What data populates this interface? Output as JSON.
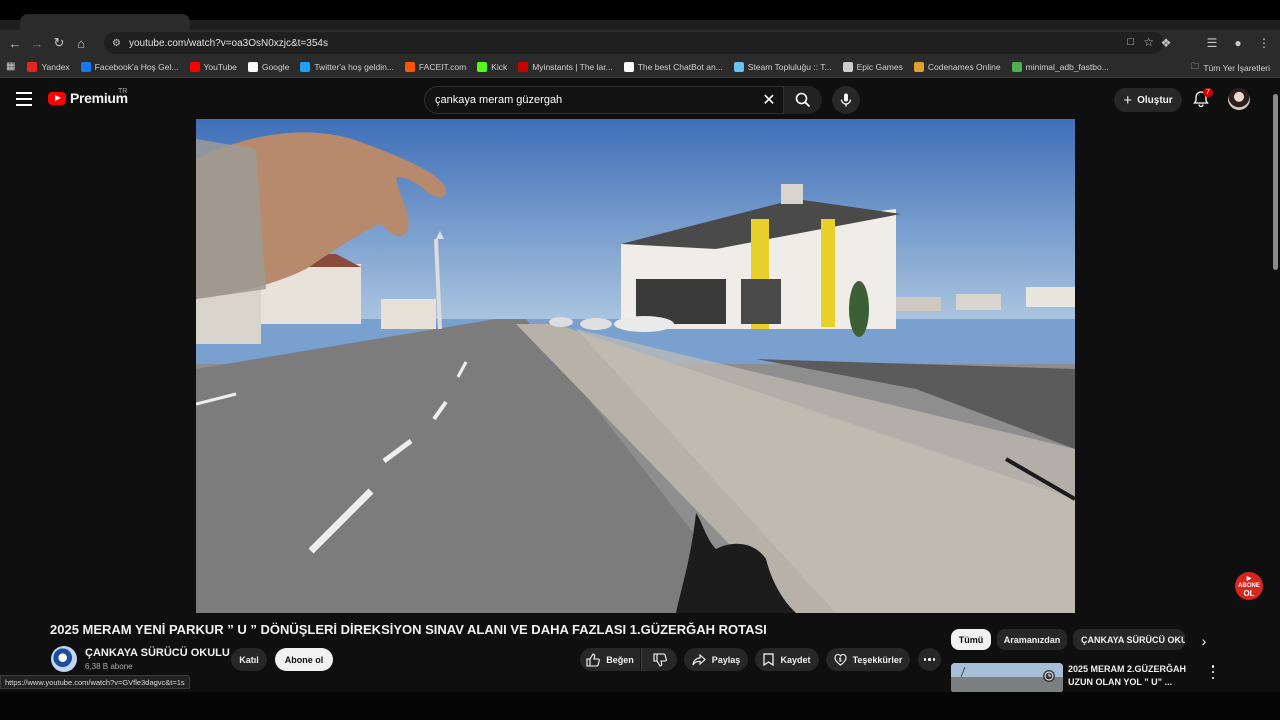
{
  "browser": {
    "url": "youtube.com/watch?v=oa3OsN0xzjc&t=354s",
    "bookmarks": [
      {
        "label": "Yandex",
        "color": "#e52620"
      },
      {
        "label": "Facebook'a Hoş Gel...",
        "color": "#1877f2"
      },
      {
        "label": "YouTube",
        "color": "#ff0000"
      },
      {
        "label": "Google",
        "color": "#ffffff"
      },
      {
        "label": "Twitter'a hoş geldin...",
        "color": "#1da1f2"
      },
      {
        "label": "FACEIT.com",
        "color": "#ff5500"
      },
      {
        "label": "Kick",
        "color": "#53fc18"
      },
      {
        "label": "Myinstants | The lar...",
        "color": "#cc0000"
      },
      {
        "label": "The best ChatBot an...",
        "color": "#ffffff"
      },
      {
        "label": "Steam Topluluğu :: T...",
        "color": "#66c0f4"
      },
      {
        "label": "Epic Games",
        "color": "#cccccc"
      },
      {
        "label": "Codenames Online",
        "color": "#e0a030"
      },
      {
        "label": "minimal_adb_fastbo...",
        "color": "#4caf50"
      }
    ],
    "all_bookmarks_label": "Tüm Yer İşaretleri",
    "status_url": "https://www.youtube.com/watch?v=GVfle3dagvc&t=1s"
  },
  "masthead": {
    "logo_text": "Premium",
    "region": "TR",
    "search_value": "çankaya meram güzergah",
    "create_label": "Oluştur",
    "notification_count": "7"
  },
  "video": {
    "title": "2025 MERAM YENİ PARKUR ” U ” DÖNÜŞLERİ DİREKSİYON SINAV ALANI VE DAHA FAZLASI 1.GÜZERĞAH ROTASI",
    "badge_line1": "ABONE",
    "badge_line2": "OL"
  },
  "channel": {
    "name": "ÇANKAYA SÜRÜCÜ OKULU",
    "subscribers": "6,38 B abone",
    "join_label": "Katıl",
    "subscribe_label": "Abone ol"
  },
  "actions": {
    "like": "Beğen",
    "share": "Paylaş",
    "save": "Kaydet",
    "thanks": "Teşekkürler"
  },
  "chips": [
    "Tümü",
    "Aramanızdan",
    "ÇANKAYA SÜRÜCÜ OKULU"
  ],
  "recommendation": {
    "title": "2025 MERAM 2.GÜZERĞAH UZUN OLAN YOL ” U” ..."
  }
}
